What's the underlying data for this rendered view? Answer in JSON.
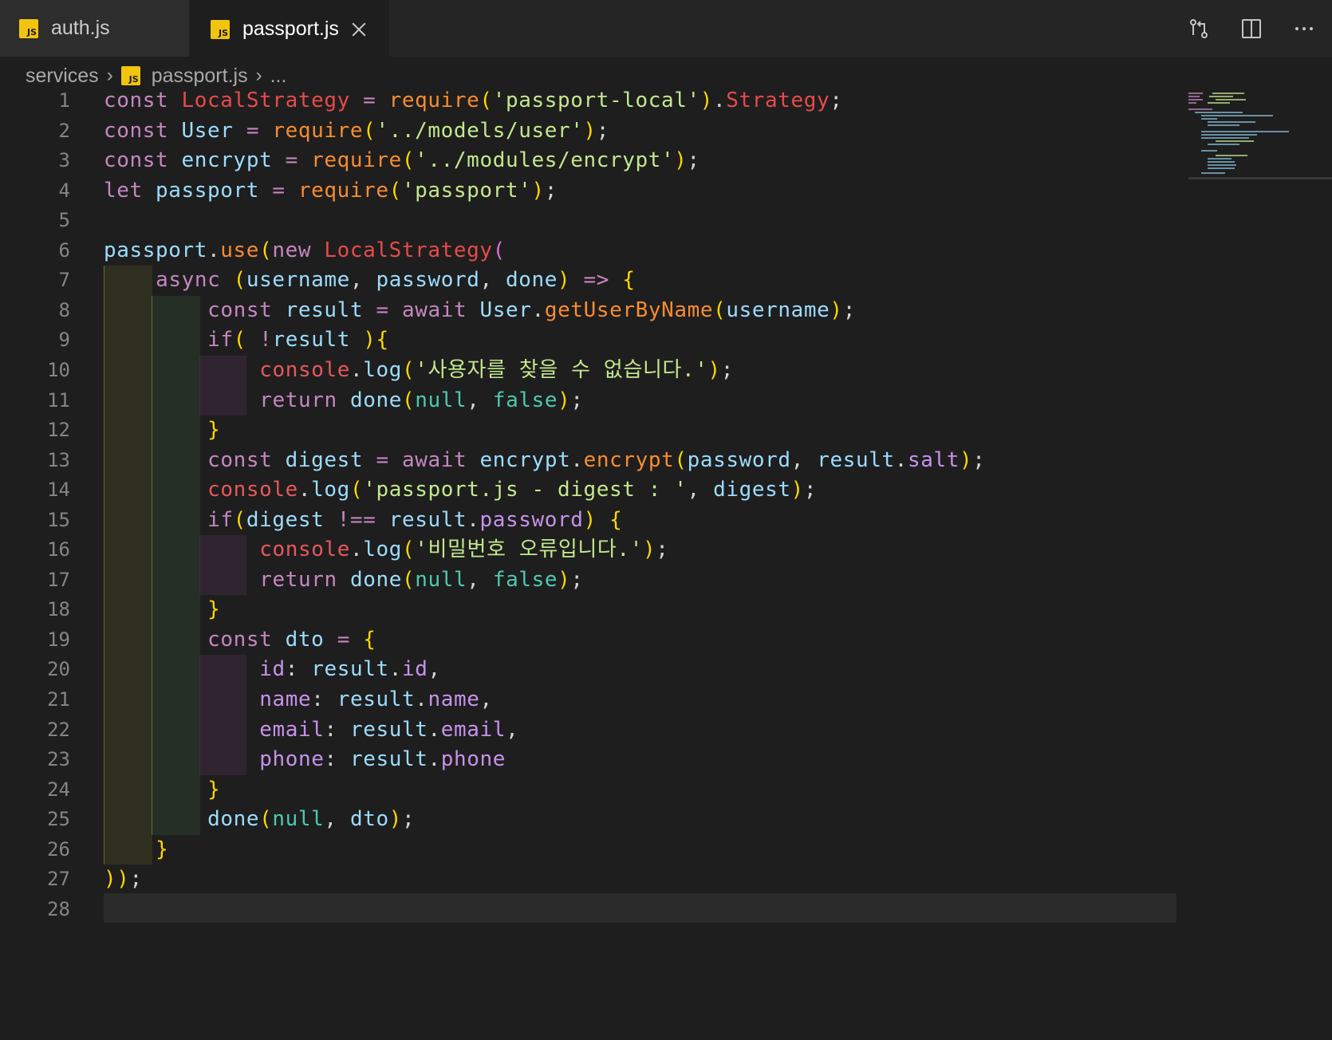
{
  "tabs": [
    {
      "label": "auth.js",
      "icon": "js-icon",
      "active": false
    },
    {
      "label": "passport.js",
      "icon": "js-icon",
      "active": true
    }
  ],
  "breadcrumb": {
    "folder": "services",
    "file": "passport.js",
    "more": "..."
  },
  "actions": [
    "compare-changes-icon",
    "split-editor-icon",
    "more-actions-icon"
  ],
  "editor": {
    "line_numbers": [
      "1",
      "2",
      "3",
      "4",
      "5",
      "6",
      "7",
      "8",
      "9",
      "10",
      "11",
      "12",
      "13",
      "14",
      "15",
      "16",
      "17",
      "18",
      "19",
      "20",
      "21",
      "22",
      "23",
      "24",
      "25",
      "26",
      "27",
      "28"
    ],
    "lines": [
      "const LocalStrategy = require('passport-local').Strategy;",
      "const User = require('../models/user');",
      "const encrypt = require('../modules/encrypt');",
      "let passport = require('passport');",
      "",
      "passport.use(new LocalStrategy(",
      "    async (username, password, done) => {",
      "        const result = await User.getUserByName(username);",
      "        if( !result ){",
      "            console.log('사용자를 찾을 수 없습니다.');",
      "            return done(null, false);",
      "        }",
      "        const digest = await encrypt.encrypt(password, result.salt);",
      "        console.log('passport.js - digest : ', digest);",
      "        if(digest !== result.password) {",
      "            console.log('비밀번호 오류입니다.');",
      "            return done(null, false);",
      "        }",
      "        const dto = {",
      "            id: result.id,",
      "            name: result.name,",
      "            email: result.email,",
      "            phone: result.phone",
      "        }",
      "        done(null, dto);",
      "    }",
      "));",
      ""
    ]
  },
  "colors": {
    "background": "#1e1e1e",
    "tab_bar": "#252526",
    "keyword": "#c586c0",
    "string": "#c3e88d",
    "function": "#f78c30",
    "variable": "#9cdcfe",
    "error_class": "#e84a4a",
    "literal": "#4ec9b0",
    "bracket_1": "#ffd700",
    "bracket_2": "#da70d6",
    "bracket_3": "#179fff"
  }
}
